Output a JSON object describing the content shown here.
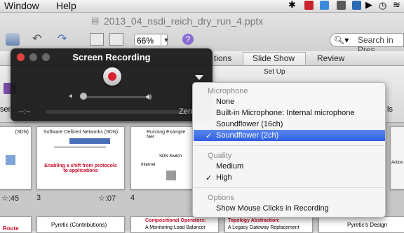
{
  "menubar": {
    "items": [
      "Window",
      "Help"
    ]
  },
  "document": {
    "title": "2013_04_nsdi_reich_dry_run_4.pptx"
  },
  "toolbar": {
    "zoom": "66%",
    "search_placeholder": "Search in Pres"
  },
  "ribbon": {
    "tabs": [
      "tions",
      "Slide Show",
      "Review"
    ],
    "group_label": "Set Up",
    "cut_left": "sen",
    "cut_right": "ls",
    "cut_zero": "Zero"
  },
  "recording": {
    "title": "Screen Recording",
    "time_elapsed": "--:--",
    "time_remaining": "Zero"
  },
  "menu": {
    "microphone_header": "Microphone",
    "mic_none": "None",
    "mic_builtin": "Built-in Microphone: Internal microphone",
    "mic_sf16": "Soundflower (16ch)",
    "mic_sf2": "Soundflower (2ch)",
    "quality_header": "Quality",
    "quality_medium": "Medium",
    "quality_high": "High",
    "options_header": "Options",
    "show_clicks": "Show Mouse Clicks in Recording",
    "checkmark": "✓"
  },
  "slides": {
    "s2_title": "Software Defined Networks (SDN)",
    "s2_red": "Enabling a shift from protocols to applications",
    "s2_num": "3",
    "s2_time": ":07",
    "s3_title": "Running Example Net",
    "s3_switch": "SDN Switch",
    "s3_internet": "Internet",
    "s3_num": "4",
    "s1_title": "(SDN)",
    "s1_time": ":45",
    "s4_title": "Compositional Operators:",
    "s4_sub": "A Monitoring Load Balancer",
    "s5_title": "Topology Abstraction:",
    "s5_sub": "A Legacy Gateway Replacement",
    "s6_title": "Pyretic (Contributions)",
    "s7_title": "Pyretic's Design",
    "s8_route": "Route",
    "s9_action": "Action"
  },
  "colors": {
    "record_red": "#d9202f",
    "selection": "#3464e4"
  }
}
